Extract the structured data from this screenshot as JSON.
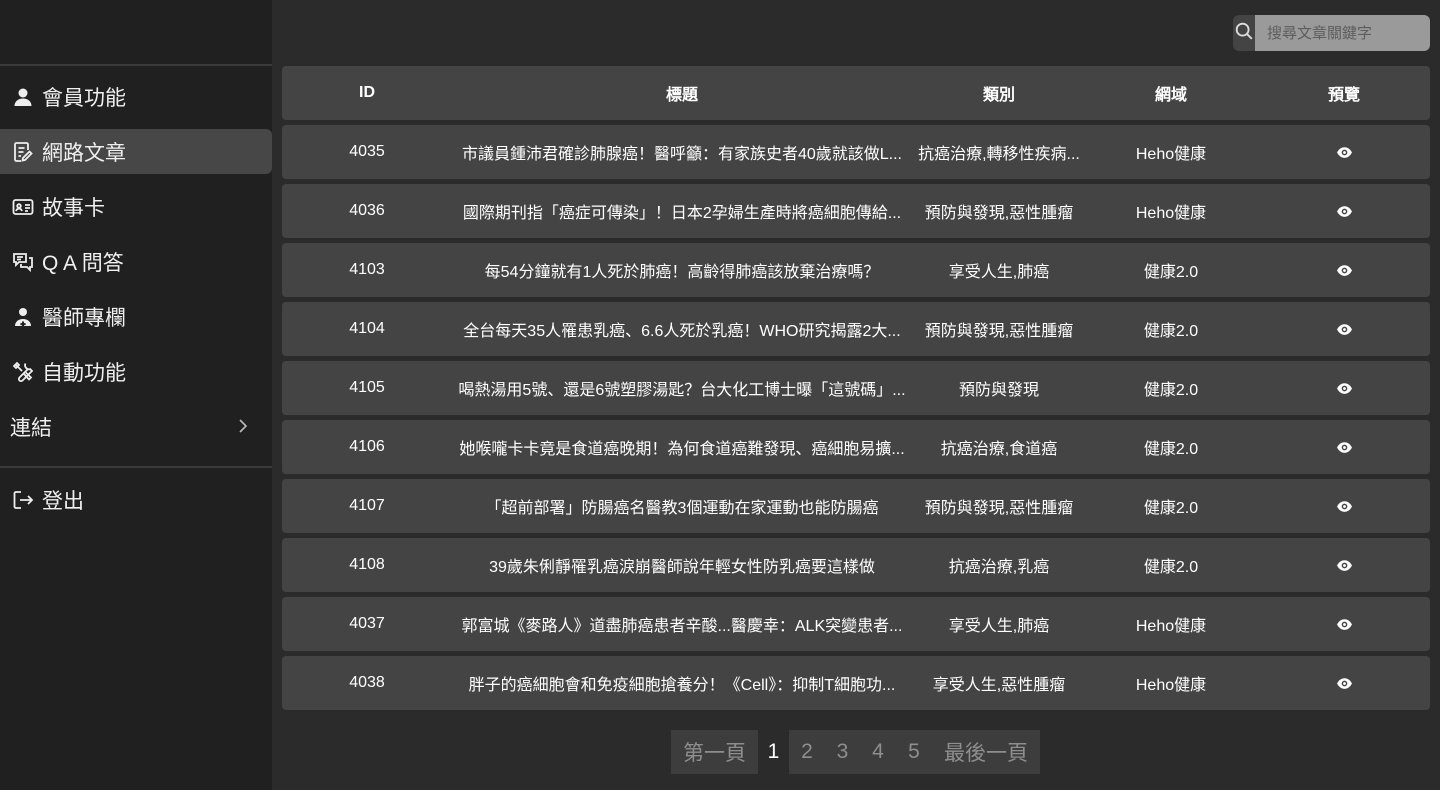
{
  "sidebar": {
    "items": [
      {
        "label": "會員功能",
        "icon": "user-icon"
      },
      {
        "label": "網路文章",
        "icon": "article-icon"
      },
      {
        "label": "故事卡",
        "icon": "id-card-icon"
      },
      {
        "label": "Q A 問答",
        "icon": "chat-icon"
      },
      {
        "label": "醫師專欄",
        "icon": "doctor-icon"
      },
      {
        "label": "自動功能",
        "icon": "tools-icon"
      },
      {
        "label": "連結",
        "icon": "chevron-right-icon"
      }
    ],
    "logout": {
      "label": "登出",
      "icon": "logout-icon"
    }
  },
  "search": {
    "placeholder": "搜尋文章關鍵字",
    "icon": "search-icon"
  },
  "table": {
    "headers": [
      "ID",
      "標題",
      "類別",
      "網域",
      "預覽"
    ],
    "rows": [
      {
        "id": "4035",
        "title": "市議員鍾沛君確診肺腺癌！醫呼籲：有家族史者40歲就該做L...",
        "category": "抗癌治療,轉移性疾病...",
        "domain": "Heho健康"
      },
      {
        "id": "4036",
        "title": "國際期刊指「癌症可傳染」！日本2孕婦生產時將癌細胞傳給...",
        "category": "預防與發現,惡性腫瘤",
        "domain": "Heho健康"
      },
      {
        "id": "4103",
        "title": "每54分鐘就有1人死於肺癌！高齡得肺癌該放棄治療嗎？",
        "category": "享受人生,肺癌",
        "domain": "健康2.0"
      },
      {
        "id": "4104",
        "title": "全台每天35人罹患乳癌、6.6人死於乳癌！WHO研究揭露2大...",
        "category": "預防與發現,惡性腫瘤",
        "domain": "健康2.0"
      },
      {
        "id": "4105",
        "title": "喝熱湯用5號、還是6號塑膠湯匙？台大化工博士曝「這號碼」...",
        "category": "預防與發現",
        "domain": "健康2.0"
      },
      {
        "id": "4106",
        "title": "她喉嚨卡卡竟是食道癌晚期！為何食道癌難發現、癌細胞易擴...",
        "category": "抗癌治療,食道癌",
        "domain": "健康2.0"
      },
      {
        "id": "4107",
        "title": "「超前部署」防腸癌名醫教3個運動在家運動也能防腸癌",
        "category": "預防與發現,惡性腫瘤",
        "domain": "健康2.0"
      },
      {
        "id": "4108",
        "title": "39歲朱俐靜罹乳癌淚崩醫師說年輕女性防乳癌要這樣做",
        "category": "抗癌治療,乳癌",
        "domain": "健康2.0"
      },
      {
        "id": "4037",
        "title": "郭富城《麥路人》道盡肺癌患者辛酸...醫慶幸：ALK突變患者...",
        "category": "享受人生,肺癌",
        "domain": "Heho健康"
      },
      {
        "id": "4038",
        "title": "胖子的癌細胞會和免疫細胞搶養分！《Cell》：抑制T細胞功...",
        "category": "享受人生,惡性腫瘤",
        "domain": "Heho健康"
      }
    ],
    "preview_icon": "eye-icon"
  },
  "pagination": {
    "first": "第一頁",
    "current": "1",
    "pages": [
      "2",
      "3",
      "4",
      "5"
    ],
    "last": "最後一頁"
  }
}
